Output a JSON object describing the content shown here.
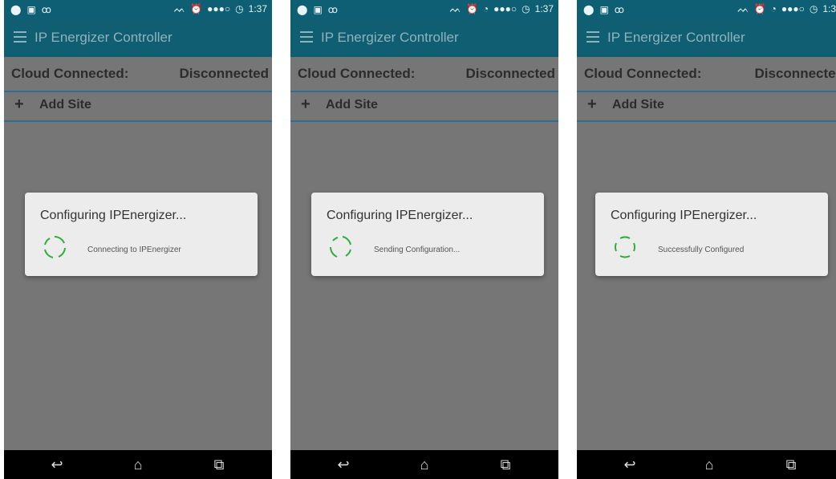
{
  "screens": [
    {
      "status": {
        "time": "1:37"
      },
      "header": {
        "title": "IP Energizer Controller"
      },
      "cloud": {
        "label": "Cloud Connected:",
        "value": "Disconnected"
      },
      "add_site": {
        "label": "Add Site"
      },
      "dialog": {
        "title": "Configuring IPEnergizer...",
        "message": "Connecting to IPEnergizer"
      }
    },
    {
      "status": {
        "time": "1:37"
      },
      "header": {
        "title": "IP Energizer Controller"
      },
      "cloud": {
        "label": "Cloud Connected:",
        "value": "Disconnected"
      },
      "add_site": {
        "label": "Add Site"
      },
      "dialog": {
        "title": "Configuring IPEnergizer...",
        "message": "Sending Configuration..."
      }
    },
    {
      "status": {
        "time": "1:3"
      },
      "header": {
        "title": "IP Energizer Controller"
      },
      "cloud": {
        "label": "Cloud Connected:",
        "value": "Disconnected"
      },
      "add_site": {
        "label": "Add Site"
      },
      "dialog": {
        "title": "Configuring IPEnergizer...",
        "message": "Successfully Configured"
      }
    }
  ],
  "icons": {
    "location": "map-pin-icon",
    "image": "image-icon",
    "voicemail": "voicemail-icon",
    "signal": "signal-dots-icon",
    "alarm": "alarm-icon",
    "wifi": "wifi-icon",
    "nfc": "nfc-icon",
    "menu": "hamburger-icon",
    "plus": "plus-icon",
    "spinner": "loading-spinner-icon",
    "back": "back-icon",
    "home": "home-icon",
    "recents": "recents-icon"
  },
  "colors": {
    "accent": "#0f5e72",
    "divider": "#2c6f91",
    "spinner": "#2fae3b",
    "overlay": "#767676"
  }
}
